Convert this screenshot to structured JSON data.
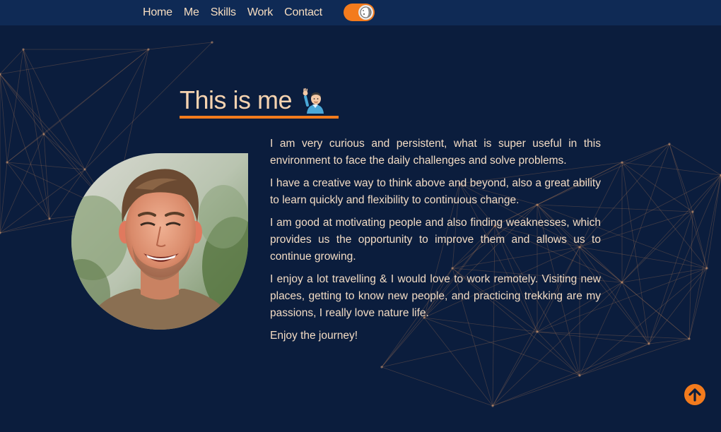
{
  "nav": {
    "items": [
      {
        "label": "Home"
      },
      {
        "label": "Me"
      },
      {
        "label": "Skills"
      },
      {
        "label": "Work"
      },
      {
        "label": "Contact"
      }
    ],
    "theme_toggle": {
      "state": "on",
      "icon": "half-moon-icon"
    }
  },
  "section": {
    "title": "This is me",
    "title_icon": "waving-man-emoji-icon",
    "paragraphs": [
      "I am very curious and persistent, what is super useful in this environment to face the daily challenges and solve problems.",
      "I have a creative way to think above and beyond, also a great ability to learn quickly and flexibility to continuous change.",
      "I am good at motivating people and also finding weaknesses, which provides us the opportunity to improve them and allows us to continue growing.",
      "I enjoy a lot travelling & I would love to work remotely. Visiting new places, getting to know new people, and practicing trekking are my passions, I really love nature life.",
      "Enjoy the journey!"
    ],
    "avatar": "profile-photo"
  },
  "scroll_top": {
    "icon": "arrow-up-icon"
  },
  "colors": {
    "background": "#0b1d3d",
    "navbar": "#0f2a55",
    "accent": "#f37b1d",
    "text": "#f3dcc4"
  }
}
